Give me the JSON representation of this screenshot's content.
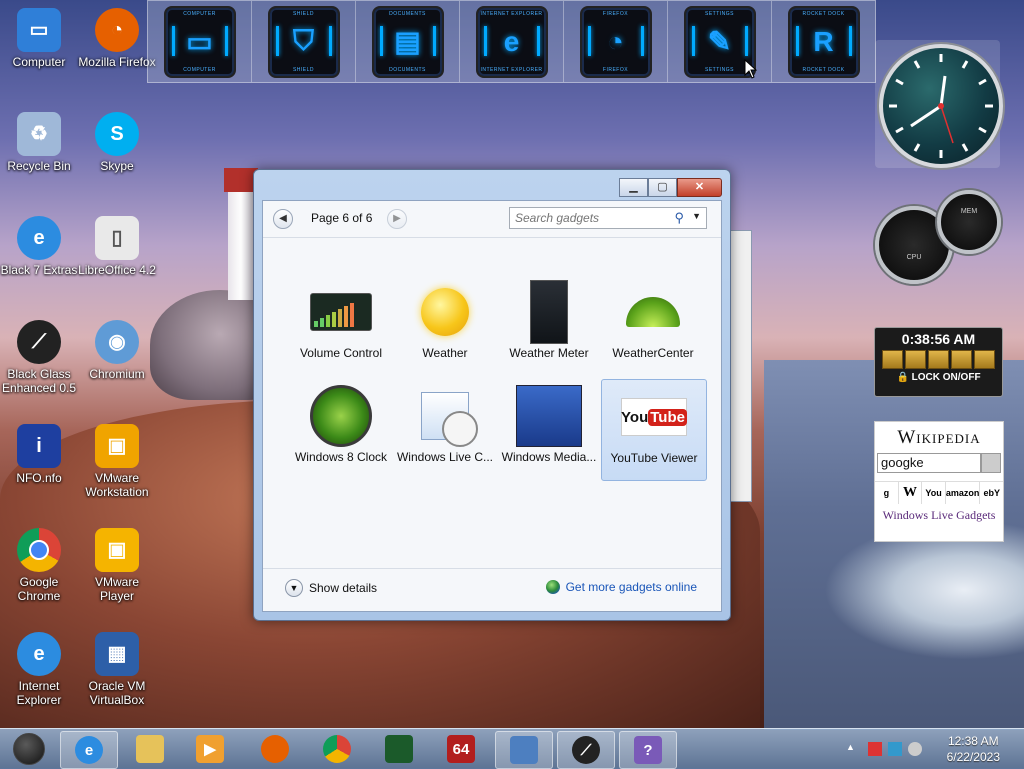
{
  "desktop": {
    "icons": [
      {
        "label": "Computer",
        "icon": "computer-icon",
        "color": "#2f7fd8"
      },
      {
        "label": "Mozilla Firefox",
        "icon": "firefox-icon",
        "color": "#e66000"
      },
      {
        "label": "Recycle Bin",
        "icon": "recycle-bin-icon",
        "color": "#9fb8d8"
      },
      {
        "label": "Skype",
        "icon": "skype-icon",
        "color": "#00aff0"
      },
      {
        "label": "Black 7 Extras",
        "icon": "internet-explorer-icon",
        "color": "#2c8ce0"
      },
      {
        "label": "LibreOffice 4.2",
        "icon": "libreoffice-icon",
        "color": "#e9e9e9"
      },
      {
        "label": "Black Glass Enhanced 0.5",
        "icon": "black-glass-icon",
        "color": "#222222"
      },
      {
        "label": "Chromium",
        "icon": "chromium-icon",
        "color": "#5f9bd6"
      },
      {
        "label": "NFO.nfo",
        "icon": "info-icon",
        "color": "#1e3fa0"
      },
      {
        "label": "VMware Workstation",
        "icon": "vmware-workstation-icon",
        "color": "#f0a400"
      },
      {
        "label": "Google Chrome",
        "icon": "chrome-icon",
        "color": "#db4437"
      },
      {
        "label": "VMware Player",
        "icon": "vmware-player-icon",
        "color": "#f5b400"
      },
      {
        "label": "Internet Explorer",
        "icon": "internet-explorer-icon",
        "color": "#2c8ce0"
      },
      {
        "label": "Oracle VM VirtualBox",
        "icon": "virtualbox-icon",
        "color": "#2d5fa8"
      }
    ]
  },
  "dock": {
    "items": [
      {
        "cap": "COMPUTER",
        "glyph": "▭",
        "icon": "computer-icon"
      },
      {
        "cap": "SHIELD",
        "glyph": "⛉",
        "icon": "shield-icon"
      },
      {
        "cap": "DOCUMENTS",
        "glyph": "▤",
        "icon": "documents-icon"
      },
      {
        "cap": "INTERNET EXPLORER",
        "glyph": "e",
        "icon": "internet-explorer-icon"
      },
      {
        "cap": "FIREFOX",
        "glyph": "◔",
        "icon": "firefox-icon"
      },
      {
        "cap": "SETTINGS",
        "glyph": "✎",
        "icon": "wrench-icon"
      },
      {
        "cap": "ROCKET DOCK",
        "glyph": "R",
        "icon": "rocketdock-icon"
      }
    ]
  },
  "gadgets_window": {
    "page_label": "Page 6 of 6",
    "search_placeholder": "Search gadgets",
    "prev_glyph": "◀",
    "next_glyph": "▶",
    "minimize_glyph": "▁",
    "maximize_glyph": "▢",
    "close_glyph": "✕",
    "gadgets": [
      {
        "label": "Volume Control",
        "icon": "volume-control-icon",
        "selected": false
      },
      {
        "label": "Weather",
        "icon": "weather-sun-icon",
        "selected": false
      },
      {
        "label": "Weather Meter",
        "icon": "weather-meter-icon",
        "selected": false
      },
      {
        "label": "WeatherCenter",
        "icon": "umbrella-icon",
        "selected": false
      },
      {
        "label": "Windows 8 Clock",
        "icon": "windows-clock-icon",
        "selected": false
      },
      {
        "label": "Windows Live C...",
        "icon": "windows-live-calendar-icon",
        "selected": false
      },
      {
        "label": "Windows Media...",
        "icon": "windows-media-icon",
        "selected": false
      },
      {
        "label": "YouTube Viewer",
        "icon": "youtube-icon",
        "selected": true
      }
    ],
    "show_details": "Show details",
    "more_link": "Get more gadgets online"
  },
  "side_gadgets": {
    "time": "0:38:56 AM",
    "lock_label": "LOCK ON/OFF",
    "wiki_logo": "Wikipedia",
    "wiki_search_value": "googke",
    "wiki_sites": [
      "g",
      "W",
      "You",
      "amazon",
      "ebY"
    ],
    "wiki_footer": "Windows Live Gadgets",
    "gauge_cpu_label": "CPU",
    "gauge_mem_label": "MEM"
  },
  "taskbar": {
    "items": [
      {
        "icon": "internet-explorer-icon",
        "color": "#2c8ce0",
        "active": true
      },
      {
        "icon": "file-explorer-icon",
        "color": "#e6c25a",
        "active": false
      },
      {
        "icon": "media-player-icon",
        "color": "#f0a030",
        "active": false
      },
      {
        "icon": "firefox-icon",
        "color": "#e66000",
        "active": false
      },
      {
        "icon": "chrome-icon",
        "color": "#db4437",
        "active": false
      },
      {
        "icon": "task-manager-icon",
        "color": "#1b5a2a",
        "active": false
      },
      {
        "icon": "cpu-z-64-icon",
        "color": "#b21e1e",
        "glyph": "64",
        "active": false
      },
      {
        "icon": "remote-desktop-icon",
        "color": "#4d7fc0",
        "active": false
      },
      {
        "icon": "black-glass-icon",
        "color": "#222222",
        "active": false
      },
      {
        "icon": "help-icon",
        "color": "#7a5ab8",
        "glyph": "?",
        "active": false
      }
    ],
    "clock_time": "12:38 AM",
    "clock_date": "6/22/2023"
  }
}
